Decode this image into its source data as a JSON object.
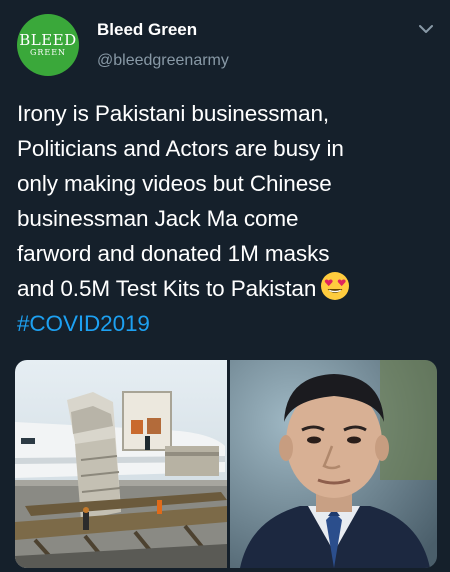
{
  "tweet": {
    "author": {
      "display_name": "Bleed Green",
      "handle": "@bleedgreenarmy",
      "avatar_logo_text": "BLEED GREEN"
    },
    "text_lines": [
      "Irony is Pakistani businessman,",
      "Politicians and Actors are busy in",
      "only making videos but Chinese",
      "businessman Jack Ma come",
      "farword and donated 1M masks",
      "and 0.5M Test Kits to Pakistan"
    ],
    "emoji": "heart-eyes-emoji",
    "hashtag": "#COVID2019",
    "media": [
      {
        "name": "cargo-plane-unloading-photo"
      },
      {
        "name": "jack-ma-portrait-photo"
      }
    ]
  },
  "colors": {
    "background": "#15202b",
    "text": "#ffffff",
    "secondary_text": "#8899a6",
    "link": "#1da1f2",
    "avatar_green": "#3aa83a"
  },
  "icons": [
    "chevron-down-icon"
  ]
}
